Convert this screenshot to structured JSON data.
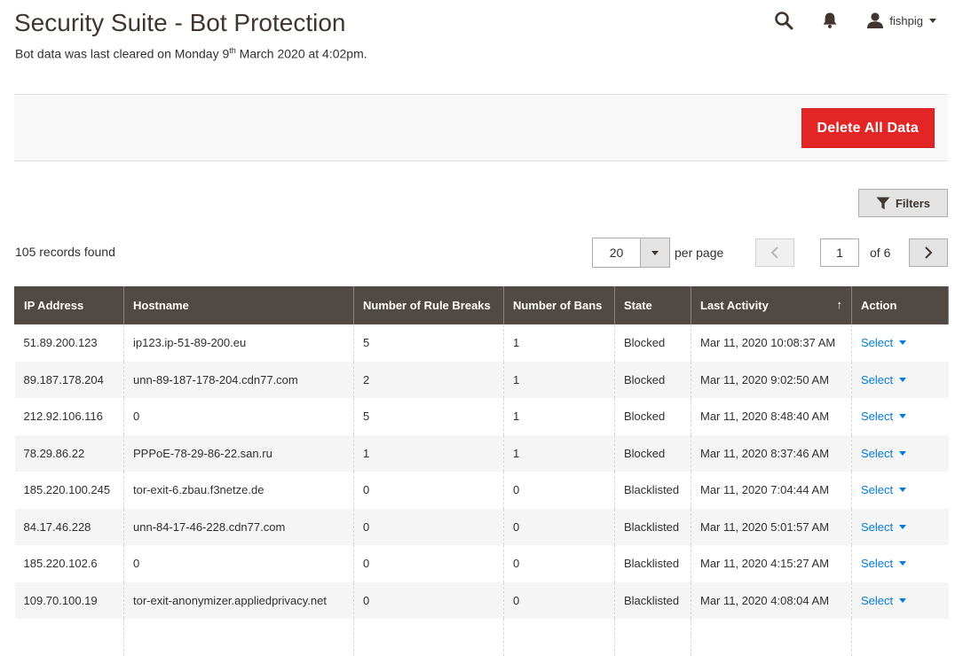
{
  "header": {
    "title": "Security Suite - Bot Protection",
    "subtitle_before": "Bot data was last cleared on Monday 9",
    "subtitle_sup": "th",
    "subtitle_after": " March 2020 at 4:02pm.",
    "user_name": "fishpig"
  },
  "actions": {
    "delete_label": "Delete All Data",
    "delete_color": "#e22626"
  },
  "toolbar": {
    "filters_label": "Filters",
    "records_found": "105 records found",
    "per_page_value": "20",
    "per_page_label": "per page",
    "current_page": "1",
    "page_of": "of 6"
  },
  "grid": {
    "columns": [
      "IP Address",
      "Hostname",
      "Number of Rule Breaks",
      "Number of Bans",
      "State",
      "Last Activity",
      "Action"
    ],
    "sort_indicator": "↑",
    "header_color": "#514943",
    "link_color": "#007bdb",
    "rows": [
      {
        "ip": "51.89.200.123",
        "hostname": "ip123.ip-51-89-200.eu",
        "rule_breaks": "5",
        "bans": "1",
        "state": "Blocked",
        "last_activity": "Mar 11, 2020 10:08:37 AM",
        "action": "Select"
      },
      {
        "ip": "89.187.178.204",
        "hostname": "unn-89-187-178-204.cdn77.com",
        "rule_breaks": "2",
        "bans": "1",
        "state": "Blocked",
        "last_activity": "Mar 11, 2020 9:02:50 AM",
        "action": "Select"
      },
      {
        "ip": "212.92.106.116",
        "hostname": "0",
        "rule_breaks": "5",
        "bans": "1",
        "state": "Blocked",
        "last_activity": "Mar 11, 2020 8:48:40 AM",
        "action": "Select"
      },
      {
        "ip": "78.29.86.22",
        "hostname": "PPPoE-78-29-86-22.san.ru",
        "rule_breaks": "1",
        "bans": "1",
        "state": "Blocked",
        "last_activity": "Mar 11, 2020 8:37:46 AM",
        "action": "Select"
      },
      {
        "ip": "185.220.100.245",
        "hostname": "tor-exit-6.zbau.f3netze.de",
        "rule_breaks": "0",
        "bans": "0",
        "state": "Blacklisted",
        "last_activity": "Mar 11, 2020 7:04:44 AM",
        "action": "Select"
      },
      {
        "ip": "84.17.46.228",
        "hostname": "unn-84-17-46-228.cdn77.com",
        "rule_breaks": "0",
        "bans": "0",
        "state": "Blacklisted",
        "last_activity": "Mar 11, 2020 5:01:57 AM",
        "action": "Select"
      },
      {
        "ip": "185.220.102.6",
        "hostname": "0",
        "rule_breaks": "0",
        "bans": "0",
        "state": "Blacklisted",
        "last_activity": "Mar 11, 2020 4:15:27 AM",
        "action": "Select"
      },
      {
        "ip": "109.70.100.19",
        "hostname": "tor-exit-anonymizer.appliedprivacy.net",
        "rule_breaks": "0",
        "bans": "0",
        "state": "Blacklisted",
        "last_activity": "Mar 11, 2020 4:08:04 AM",
        "action": "Select"
      }
    ]
  },
  "icons": {
    "search": "search-icon",
    "notifications": "bell-icon",
    "user": "user-icon",
    "filter": "funnel-icon",
    "prev": "chevron-left-icon",
    "next": "chevron-right-icon"
  }
}
